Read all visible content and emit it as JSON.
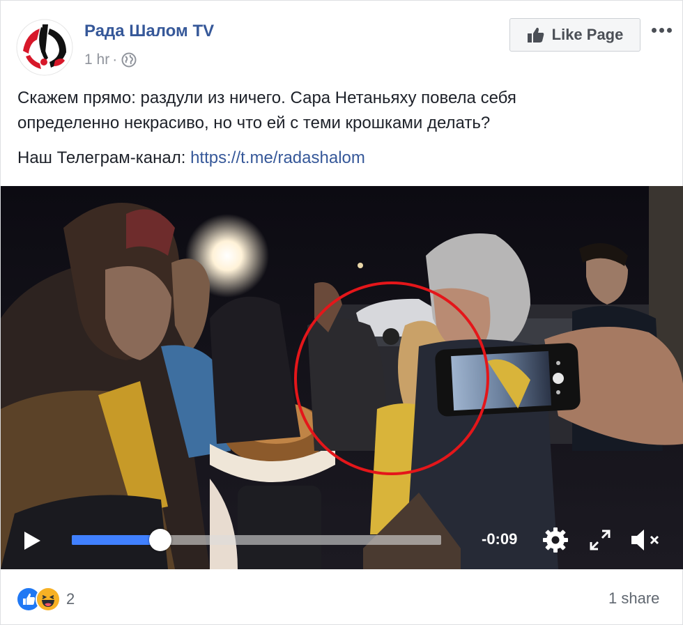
{
  "page": {
    "name": "Рада Шалом TV",
    "time": "1 hr",
    "dot": "·",
    "logo_letters": "!"
  },
  "header": {
    "like_button_label": "Like Page",
    "more_icon": "more-horizontal-icon",
    "globe_icon": "globe-icon"
  },
  "post": {
    "text_line1": "Скажем прямо: раздули из ничего. Сара Нетаньяху повела себя",
    "text_line2": "определенно некрасиво, но что ей с теми крошками делать?",
    "telegram_label": "Наш Телеграм-канал: ",
    "telegram_link": "https://t.me/radashalom"
  },
  "video": {
    "time_remaining": "-0:09",
    "progress": 0.24,
    "highlight_color": "#e4161a",
    "progress_color": "#4080ff"
  },
  "footer": {
    "reaction_icons": [
      "like-reaction-icon",
      "haha-reaction-icon"
    ],
    "reaction_count": "2",
    "shares": "1 share"
  },
  "colors": {
    "link": "#365899",
    "text": "#1d2129",
    "muted": "#90949c",
    "like_reaction": "#2078f4",
    "haha_reaction": "#f7b125"
  }
}
